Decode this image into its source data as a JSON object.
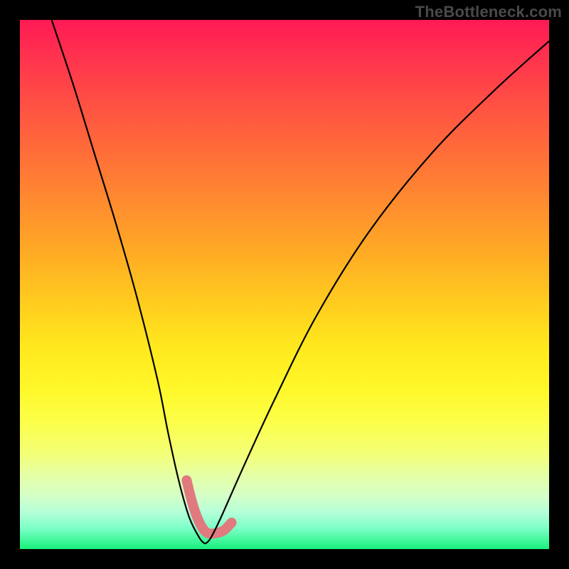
{
  "watermark": "TheBottleneck.com",
  "chart_data": {
    "type": "line",
    "title": "",
    "xlabel": "",
    "ylabel": "",
    "xlim": [
      0,
      100
    ],
    "ylim": [
      0,
      100
    ],
    "grid": false,
    "legend": false,
    "series": [
      {
        "name": "bottleneck-curve",
        "x": [
          6,
          10,
          14,
          18,
          22,
          26,
          28,
          30,
          32,
          34,
          35,
          36,
          38,
          42,
          48,
          56,
          66,
          78,
          90,
          100
        ],
        "y": [
          100,
          88,
          75,
          62,
          48,
          32,
          22,
          13,
          6,
          2,
          1,
          2,
          6,
          15,
          28,
          44,
          60,
          75,
          87,
          96
        ]
      }
    ],
    "annotations": [
      {
        "name": "highlight-near-minimum",
        "path_x": [
          31.5,
          32.5,
          33.5,
          34.5,
          35.5,
          37.0,
          38.5,
          40.0
        ],
        "path_y": [
          13,
          9,
          6,
          4,
          3,
          3,
          3.5,
          5
        ]
      }
    ],
    "colors": {
      "curve": "#000000",
      "highlight": "#e07a7f",
      "gradient_top": "#ff1a55",
      "gradient_bottom": "#18f07a"
    }
  }
}
